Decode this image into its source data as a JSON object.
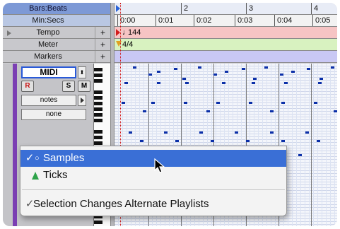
{
  "rulers": {
    "bars_beats": "Bars:Beats",
    "min_secs": "Min:Secs",
    "tempo": "Tempo",
    "meter": "Meter",
    "markers": "Markers",
    "add": "+"
  },
  "timeline": {
    "bars": [
      "2",
      "3",
      "4"
    ],
    "min_secs": [
      "0:00",
      "0:01",
      "0:02",
      "0:03",
      "0:04",
      "0:05"
    ],
    "tempo_value": "144",
    "meter_value": "4/4"
  },
  "track": {
    "name": "MIDI",
    "rec_label": "R",
    "solo_label": "S",
    "mute_label": "M",
    "view": "notes",
    "patch": "none"
  },
  "menu": {
    "items": [
      {
        "label": "Samples",
        "checked": true,
        "selected": true,
        "icon": "clock-icon"
      },
      {
        "label": "Ticks",
        "checked": false,
        "selected": false,
        "icon": "metronome-icon"
      },
      {
        "label": "Selection Changes Alternate Playlists",
        "checked": true,
        "selected": false
      }
    ],
    "check_glyph": "✓"
  },
  "colors": {
    "track_color": "#7b3fb3",
    "selection_highlight": "#3a6fd6",
    "note_color": "#0b2fa8"
  }
}
